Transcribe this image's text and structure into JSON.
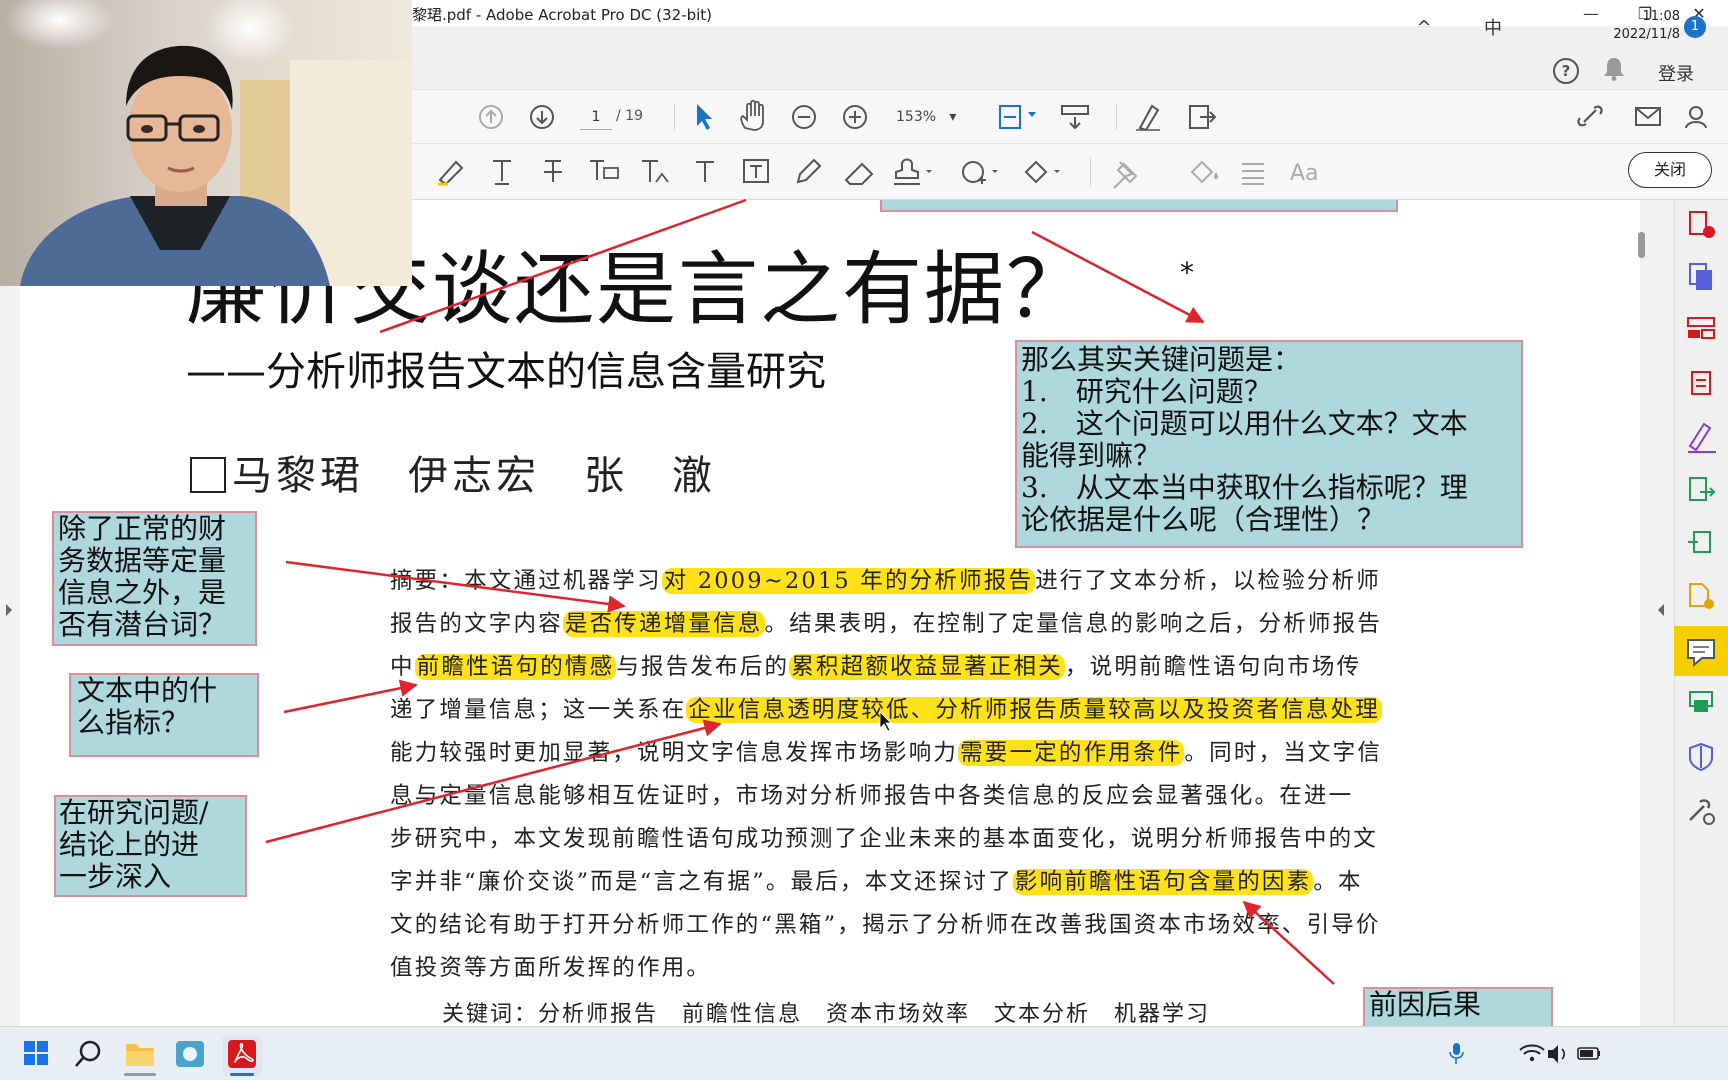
{
  "window": {
    "title": "黎珺.pdf - Adobe Acrobat Pro DC (32-bit)",
    "min_glyph": "—",
    "restore_glyph": "❐",
    "close_glyph": "✕"
  },
  "menubar": {
    "help_glyph": "?",
    "bell_glyph": "🔔",
    "login": "登录"
  },
  "toolbar": {
    "page_current": "1",
    "page_total": "/ 19",
    "zoom": "153%",
    "zoom_caret": "▾",
    "close_label": "关闭"
  },
  "document": {
    "title": "廉价交谈还是言之有据？",
    "title_marker": "*",
    "subtitle": "——分析师报告文本的信息含量研究",
    "authors": "马黎珺　伊志宏　张　澈",
    "abstract_lines": [
      {
        "segments": [
          {
            "t": "摘要：本文通过机器学习",
            "h": false
          },
          {
            "t": "对 2009~2015 年的分析师报告",
            "h": true
          },
          {
            "t": "进行了文本分析，以检验分析师",
            "h": false
          }
        ]
      },
      {
        "segments": [
          {
            "t": "报告的文字内容",
            "h": false
          },
          {
            "t": "是否传递增量信息",
            "h": true
          },
          {
            "t": "。结果表明，在控制了定量信息的影响之后，分析师报告",
            "h": false
          }
        ]
      },
      {
        "segments": [
          {
            "t": "中",
            "h": false
          },
          {
            "t": "前瞻性语句的情感",
            "h": true
          },
          {
            "t": "与报告发布后的",
            "h": false
          },
          {
            "t": "累积超额收益显著正相关",
            "h": true
          },
          {
            "t": "，说明前瞻性语句向市场传",
            "h": false
          }
        ]
      },
      {
        "segments": [
          {
            "t": "递了增量信息；这一关系在",
            "h": false
          },
          {
            "t": "企业信息透明度较低、分析师报告质量较高以及投资者信息处理",
            "h": true
          }
        ]
      },
      {
        "segments": [
          {
            "t": "能力较强时更加显著，说明文字信息发挥市场影响力",
            "h": false
          },
          {
            "t": "需要一定的作用条件",
            "h": true
          },
          {
            "t": "。同时，当文字信",
            "h": false
          }
        ]
      },
      {
        "segments": [
          {
            "t": "息与定量信息能够相互佐证时，市场对分析师报告中各类信息的反应会显著强化。在进一",
            "h": false
          }
        ]
      },
      {
        "segments": [
          {
            "t": "步研究中，本文发现前瞻性语句成功预测了企业未来的基本面变化，说明分析师报告中的文",
            "h": false
          }
        ]
      },
      {
        "segments": [
          {
            "t": "字并非“廉价交谈”而是“言之有据”。最后，本文还探讨了",
            "h": false
          },
          {
            "t": "影响前瞻性语句含量的因素",
            "h": true
          },
          {
            "t": "。本",
            "h": false
          }
        ]
      },
      {
        "segments": [
          {
            "t": "文的结论有助于打开分析师工作的“黑箱”，揭示了分析师在改善我国资本市场效率、引导价",
            "h": false
          }
        ]
      },
      {
        "segments": [
          {
            "t": "值投资等方面所发挥的作用。",
            "h": false
          }
        ]
      }
    ],
    "keywords": "关键词：分析师报告　前瞻性信息　资本市场效率　文本分析　机器学习"
  },
  "comments": {
    "key_questions": [
      "那么其实关键问题是：",
      "1.　研究什么问题？",
      "2.　这个问题可以用什么文本？文本",
      "能得到嘛？",
      "3.　从文本当中获取什么指标呢？理",
      "论依据是什么呢（合理性）？"
    ],
    "quant": [
      "除了正常的财",
      "务数据等定量",
      "信息之外，是",
      "否有潜台词？"
    ],
    "indicator": [
      "文本中的什",
      "么指标？"
    ],
    "deeper": [
      "在研究问题/",
      "结论上的进",
      "一步深入"
    ],
    "cause": [
      "前因后果"
    ]
  },
  "taskbar": {
    "time": "11:08",
    "date": "2022/11/8",
    "ime": "中",
    "notif_count": "1",
    "tray_chevron": "^"
  },
  "colors": {
    "highlight": "#ffe11a",
    "comment_fill": "#aed8dc",
    "comment_border": "#d98f9a",
    "arrow": "#e0242e",
    "acrobat_red": "#d7191e",
    "active_tool": "#f5d000"
  },
  "icons": {
    "toolbar1": [
      "page-up-icon",
      "page-down-icon",
      "select-arrow-icon",
      "hand-icon",
      "zoom-out-icon",
      "zoom-in-icon",
      "fit-page-icon",
      "scroll-mode-icon",
      "sign-icon",
      "export-icon",
      "share-link-icon",
      "email-icon",
      "account-icon"
    ],
    "toolbar2": [
      "highlight-pen-icon",
      "text-icon",
      "strikethrough-icon",
      "replace-text-icon",
      "insert-text-icon",
      "typewriter-icon",
      "textbox-icon",
      "pencil-icon",
      "eraser-icon",
      "stamp-icon",
      "attach-icon",
      "shapes-icon",
      "pin-icon",
      "fill-color-icon",
      "line-weight-icon",
      "font-size-icon"
    ],
    "rightpanel": [
      "create-pdf-icon",
      "combine-files-icon",
      "organize-pages-icon",
      "edit-pdf-icon",
      "fill-sign-icon",
      "export-pdf-icon",
      "compress-icon",
      "create-pdf2-icon",
      "comment-icon",
      "print-production-icon",
      "protect-icon",
      "more-tools-icon"
    ]
  }
}
